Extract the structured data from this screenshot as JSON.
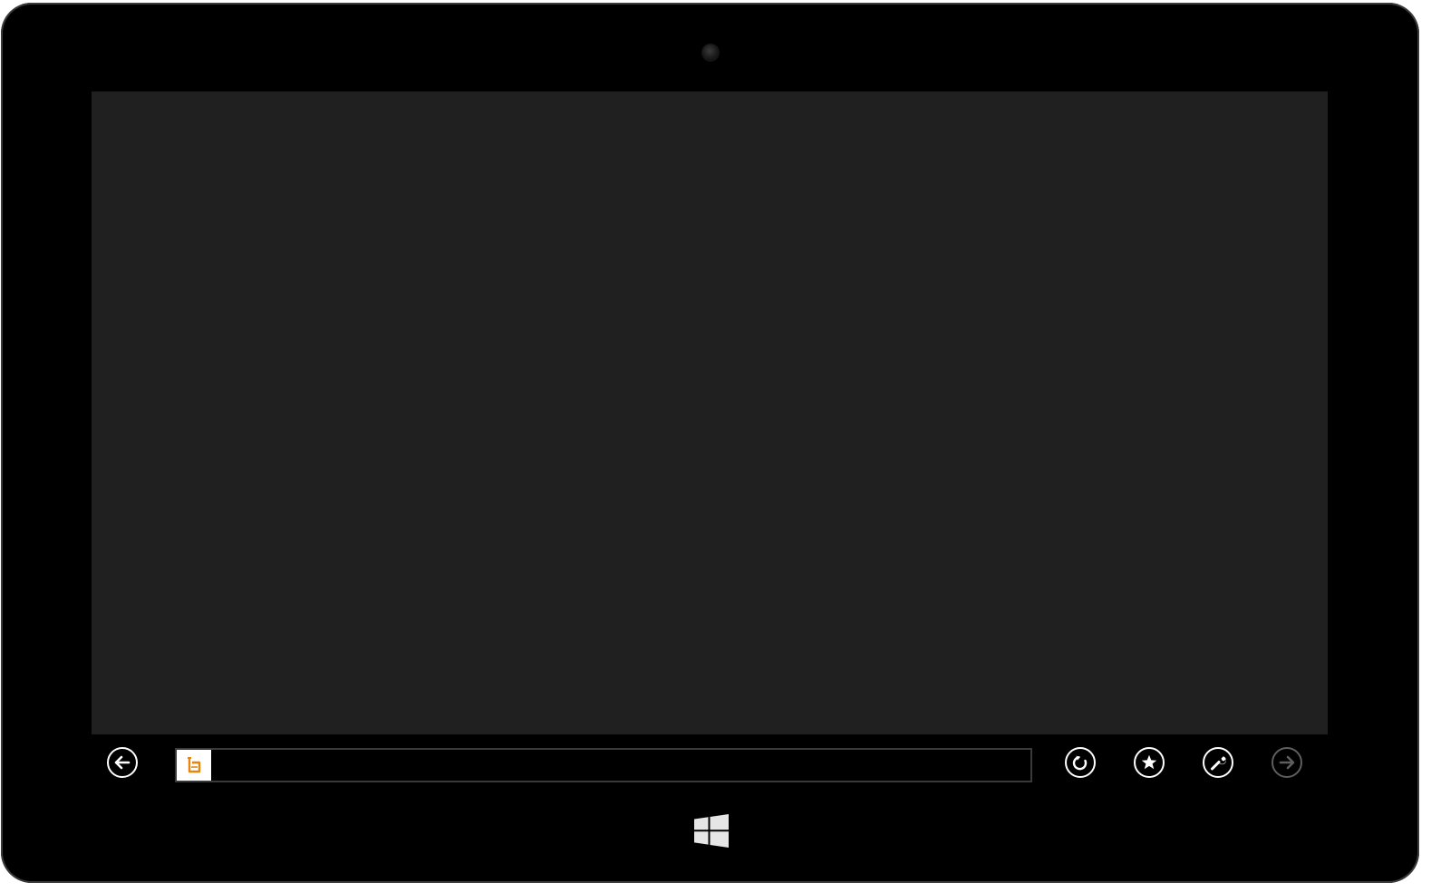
{
  "colors": {
    "bezel": "#000000",
    "screen": "#202020",
    "app_bar": "#000000",
    "icon_active": "#ffffff",
    "icon_disabled": "#5e5e5e",
    "favicon_accent": "#e8860c"
  },
  "app_bar": {
    "address": {
      "value": "",
      "placeholder": ""
    },
    "buttons": [
      {
        "name": "back",
        "icon": "arrow-left-icon",
        "enabled": true
      },
      {
        "name": "refresh",
        "icon": "refresh-icon",
        "enabled": true
      },
      {
        "name": "favorites",
        "icon": "star-icon",
        "enabled": true
      },
      {
        "name": "tools",
        "icon": "wrench-icon",
        "enabled": true
      },
      {
        "name": "forward",
        "icon": "arrow-right-icon",
        "enabled": false
      }
    ]
  },
  "hardware": {
    "start_button_icon": "windows-logo-icon",
    "camera_icon": "camera-icon"
  }
}
